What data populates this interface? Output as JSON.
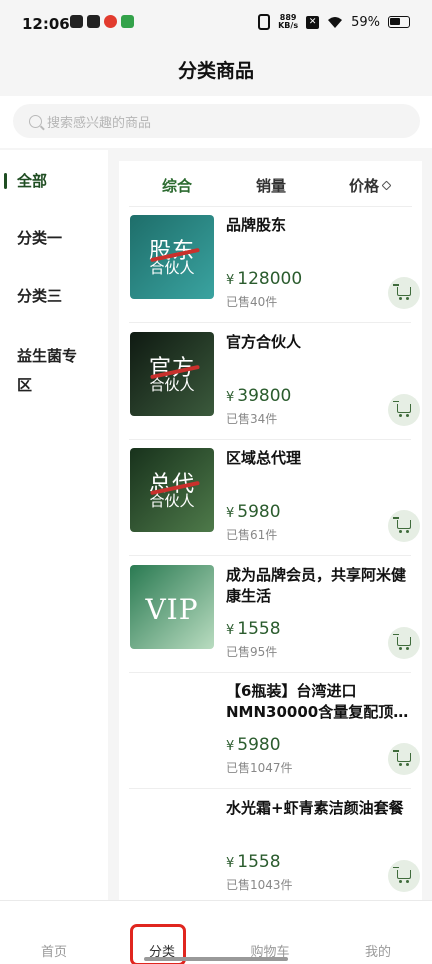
{
  "status_bar": {
    "time": "12:06",
    "net_speed_value": "889",
    "net_speed_unit": "KB/s",
    "battery": "59%"
  },
  "header": {
    "title": "分类商品"
  },
  "search": {
    "placeholder": "搜索感兴趣的商品"
  },
  "sidebar": {
    "items": [
      {
        "label": "全部",
        "active": true
      },
      {
        "label": "分类一",
        "active": false
      },
      {
        "label": "分类三",
        "active": false
      },
      {
        "label": "益生菌专区",
        "active": false
      }
    ]
  },
  "sort": {
    "items": [
      {
        "label": "综合",
        "active": true
      },
      {
        "label": "销量",
        "active": false
      },
      {
        "label": "价格",
        "active": false
      }
    ]
  },
  "products": [
    {
      "name": "品牌股东",
      "currency": "¥",
      "price": "128000",
      "sold": "已售40件",
      "thumb": {
        "big": "股东",
        "small": "合伙人",
        "colors": [
          "#1e6e6a",
          "#3aa3a0"
        ]
      }
    },
    {
      "name": "官方合伙人",
      "currency": "¥",
      "price": "39800",
      "sold": "已售34件",
      "thumb": {
        "big": "官方",
        "small": "合伙人",
        "colors": [
          "#0f1a12",
          "#3b5a3c"
        ]
      }
    },
    {
      "name": "区域总代理",
      "currency": "¥",
      "price": "5980",
      "sold": "已售61件",
      "thumb": {
        "big": "总代",
        "small": "合伙人",
        "colors": [
          "#18321c",
          "#4e7a4a"
        ]
      }
    },
    {
      "name": "成为品牌会员，共享阿米健康生活",
      "currency": "¥",
      "price": "1558",
      "sold": "已售95件",
      "thumb": {
        "big": "VIP",
        "small": "",
        "colors": [
          "#2a7a52",
          "#b9dcc0"
        ]
      }
    },
    {
      "name": "【6瓶装】台湾进口NMN30000含量复配顶…",
      "currency": "¥",
      "price": "5980",
      "sold": "已售1047件",
      "thumb": null
    },
    {
      "name": "水光霜+虾青素洁颜油套餐",
      "currency": "¥",
      "price": "1558",
      "sold": "已售1043件",
      "thumb": null
    }
  ],
  "tabbar": {
    "items": [
      {
        "label": "首页",
        "active": false
      },
      {
        "label": "分类",
        "active": true
      },
      {
        "label": "购物车",
        "active": false
      },
      {
        "label": "我的",
        "active": false
      }
    ],
    "highlight_color": "#e0261f"
  },
  "colors": {
    "accent": "#2b5c2e",
    "price": "#2b5c2e",
    "cart_bg": "#e6eee4"
  }
}
